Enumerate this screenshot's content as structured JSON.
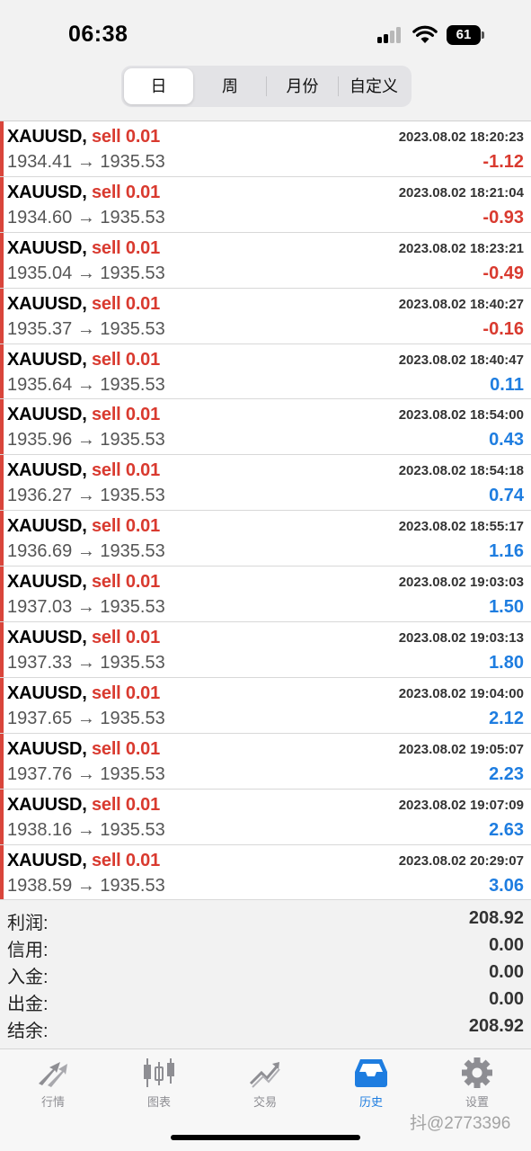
{
  "status": {
    "time": "06:38",
    "battery": "61"
  },
  "tabs_period": [
    "日",
    "周",
    "月份",
    "自定义"
  ],
  "trades": [
    {
      "symbol": "XAUUSD,",
      "side": "sell 0.01",
      "time": "2023.08.02 18:20:23",
      "prices": "1934.41 → 1935.53",
      "profit": "-1.12"
    },
    {
      "symbol": "XAUUSD,",
      "side": "sell 0.01",
      "time": "2023.08.02 18:21:04",
      "prices": "1934.60 → 1935.53",
      "profit": "-0.93"
    },
    {
      "symbol": "XAUUSD,",
      "side": "sell 0.01",
      "time": "2023.08.02 18:23:21",
      "prices": "1935.04 → 1935.53",
      "profit": "-0.49"
    },
    {
      "symbol": "XAUUSD,",
      "side": "sell 0.01",
      "time": "2023.08.02 18:40:27",
      "prices": "1935.37 → 1935.53",
      "profit": "-0.16"
    },
    {
      "symbol": "XAUUSD,",
      "side": "sell 0.01",
      "time": "2023.08.02 18:40:47",
      "prices": "1935.64 → 1935.53",
      "profit": "0.11"
    },
    {
      "symbol": "XAUUSD,",
      "side": "sell 0.01",
      "time": "2023.08.02 18:54:00",
      "prices": "1935.96 → 1935.53",
      "profit": "0.43"
    },
    {
      "symbol": "XAUUSD,",
      "side": "sell 0.01",
      "time": "2023.08.02 18:54:18",
      "prices": "1936.27 → 1935.53",
      "profit": "0.74"
    },
    {
      "symbol": "XAUUSD,",
      "side": "sell 0.01",
      "time": "2023.08.02 18:55:17",
      "prices": "1936.69 → 1935.53",
      "profit": "1.16"
    },
    {
      "symbol": "XAUUSD,",
      "side": "sell 0.01",
      "time": "2023.08.02 19:03:03",
      "prices": "1937.03 → 1935.53",
      "profit": "1.50"
    },
    {
      "symbol": "XAUUSD,",
      "side": "sell 0.01",
      "time": "2023.08.02 19:03:13",
      "prices": "1937.33 → 1935.53",
      "profit": "1.80"
    },
    {
      "symbol": "XAUUSD,",
      "side": "sell 0.01",
      "time": "2023.08.02 19:04:00",
      "prices": "1937.65 → 1935.53",
      "profit": "2.12"
    },
    {
      "symbol": "XAUUSD,",
      "side": "sell 0.01",
      "time": "2023.08.02 19:05:07",
      "prices": "1937.76 → 1935.53",
      "profit": "2.23"
    },
    {
      "symbol": "XAUUSD,",
      "side": "sell 0.01",
      "time": "2023.08.02 19:07:09",
      "prices": "1938.16 → 1935.53",
      "profit": "2.63"
    },
    {
      "symbol": "XAUUSD,",
      "side": "sell 0.01",
      "time": "2023.08.02 20:29:07",
      "prices": "1938.59 → 1935.53",
      "profit": "3.06"
    }
  ],
  "summary": [
    {
      "label": "利润:",
      "value": "208.92"
    },
    {
      "label": "信用:",
      "value": "0.00"
    },
    {
      "label": "入金:",
      "value": "0.00"
    },
    {
      "label": "出金:",
      "value": "0.00"
    },
    {
      "label": "结余:",
      "value": "208.92"
    }
  ],
  "tabbar": [
    {
      "label": "行情",
      "icon": "quotes-arrows-icon"
    },
    {
      "label": "图表",
      "icon": "candlestick-chart-icon"
    },
    {
      "label": "交易",
      "icon": "trade-trend-icon"
    },
    {
      "label": "历史",
      "icon": "history-inbox-icon"
    },
    {
      "label": "设置",
      "icon": "gear-icon"
    }
  ],
  "watermark": "抖@2773396",
  "colors": {
    "loss": "#d93a2f",
    "profit": "#1e7de0",
    "accent": "#1e7de0"
  }
}
